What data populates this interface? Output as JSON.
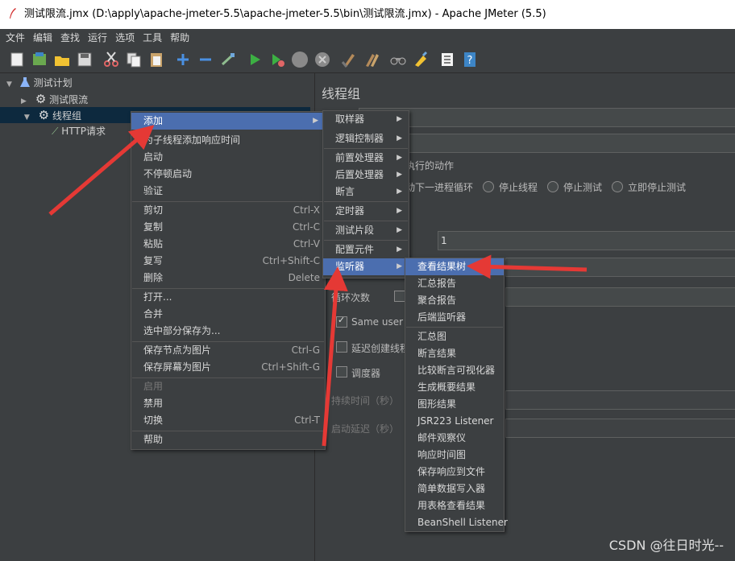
{
  "window": {
    "title": "测试限流.jmx (D:\\apply\\apache-jmeter-5.5\\apache-jmeter-5.5\\bin\\测试限流.jmx) - Apache JMeter (5.5)"
  },
  "menubar": [
    "文件",
    "编辑",
    "查找",
    "运行",
    "选项",
    "工具",
    "帮助"
  ],
  "toolbar_icons": [
    "new-icon",
    "templates-icon",
    "open-icon",
    "save-icon",
    "cut-icon",
    "copy-icon",
    "paste-icon",
    "expand-icon",
    "collapse-icon",
    "toggle-icon",
    "start-icon",
    "start-no-pause-icon",
    "stop-icon",
    "shutdown-icon",
    "clear-icon",
    "clear-all-icon",
    "search-icon",
    "reset-search-icon",
    "function-helper-icon",
    "help-icon"
  ],
  "tree": {
    "plan": "测试计划",
    "item1": "测试限流",
    "item2": "线程组",
    "item3": "HTTP请求"
  },
  "panel": {
    "title": "线程组",
    "action_group": "执行的动作",
    "radio_next_loop": "动下一进程循环",
    "radio_stop_thread": "停止线程",
    "radio_stop_test": "停止测试",
    "radio_stop_now": "立即停止测试",
    "ramp_value": "1",
    "loop_label": "循环次数",
    "same_user": "Same user on",
    "delay_create": "延迟创建线程",
    "scheduler": "调度器",
    "duration": "持续时间（秒）",
    "startup_delay": "启动延迟（秒）"
  },
  "context_menu": {
    "add": "添加",
    "add_think_time": "为子线程添加响应时间",
    "start": "启动",
    "start_no_pause": "不停顿启动",
    "validate": "验证",
    "cut": "剪切",
    "cut_key": "Ctrl-X",
    "copy": "复制",
    "copy_key": "Ctrl-C",
    "paste": "粘贴",
    "paste_key": "Ctrl-V",
    "duplicate": "复写",
    "duplicate_key": "Ctrl+Shift-C",
    "delete": "删除",
    "delete_key": "Delete",
    "open": "打开...",
    "merge": "合并",
    "save_selection": "选中部分保存为...",
    "save_node_image": "保存节点为图片",
    "save_node_image_key": "Ctrl-G",
    "save_screen_image": "保存屏幕为图片",
    "save_screen_image_key": "Ctrl+Shift-G",
    "enable": "启用",
    "disable": "禁用",
    "toggle": "切换",
    "toggle_key": "Ctrl-T",
    "help": "帮助"
  },
  "add_submenu": [
    "取样器",
    "逻辑控制器",
    "前置处理器",
    "后置处理器",
    "断言",
    "定时器",
    "测试片段",
    "配置元件",
    "监听器"
  ],
  "listener_submenu": {
    "group1": [
      "查看结果树",
      "汇总报告",
      "聚合报告",
      "后端监听器"
    ],
    "group2": [
      "汇总图",
      "断言结果",
      "比较断言可视化器",
      "生成概要结果",
      "图形结果",
      "JSR223 Listener",
      "邮件观察仪",
      "响应时间图",
      "保存响应到文件",
      "简单数据写入器",
      "用表格查看结果",
      "BeanShell Listener"
    ]
  },
  "watermark": "CSDN @往日时光--",
  "colors": {
    "highlight": "#4b6eaf",
    "arrow": "#e53935",
    "background": "#3c3f41"
  }
}
